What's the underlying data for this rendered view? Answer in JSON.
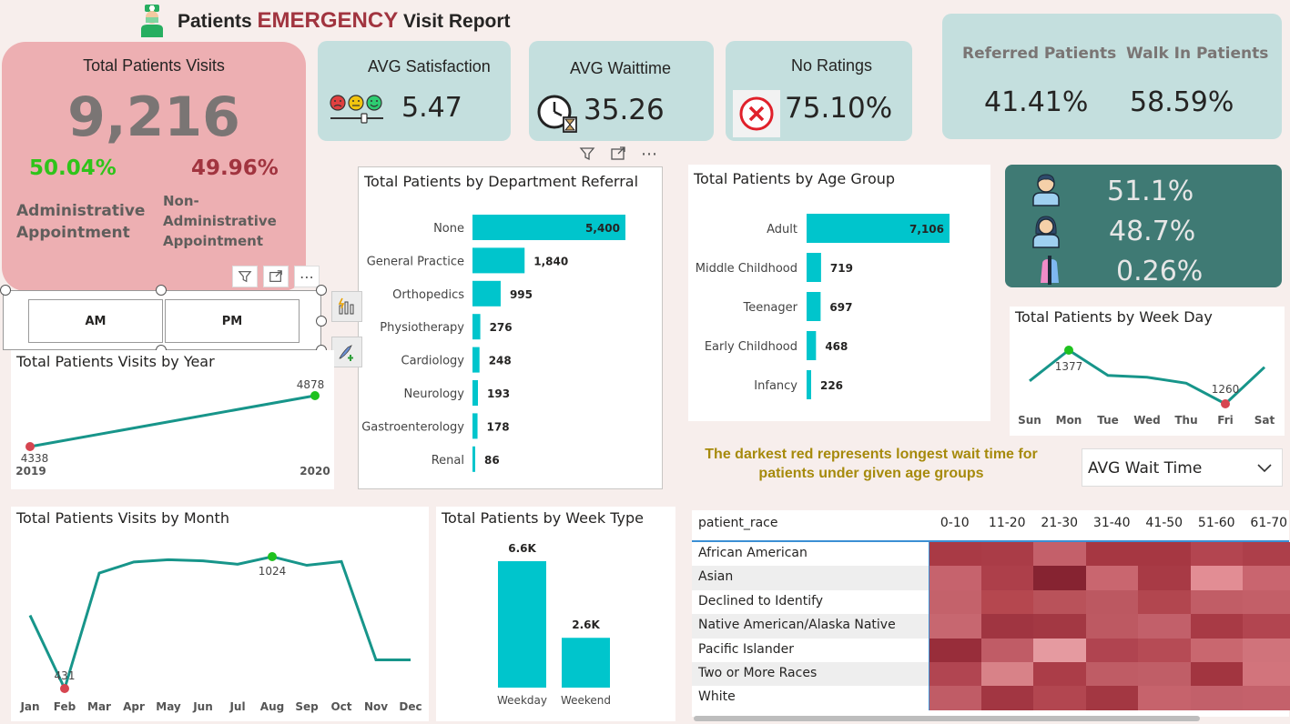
{
  "header": {
    "title_prefix": "Patients ",
    "title_highlight": "EMERGENCY",
    "title_suffix": " Visit Report"
  },
  "total_visits": {
    "label": "Total Patients Visits",
    "value": "9,216",
    "admin_pct": "50.04%",
    "admin_label_1": "Administrative",
    "admin_label_2": "Appointment",
    "nonadmin_pct": "49.96%",
    "nonadmin_label_1": "Non-",
    "nonadmin_label_2": "Administrative",
    "nonadmin_label_3": "Appointment"
  },
  "kpis": {
    "satisfaction_label": "AVG Satisfaction",
    "satisfaction_value": "5.47",
    "waittime_label": "AVG Waittime",
    "waittime_value": "35.26",
    "noratings_label": "No Ratings",
    "noratings_value": "75.10%",
    "referred_label": "Referred Patients",
    "referred_value": "41.41%",
    "walkin_label": "Walk In Patients",
    "walkin_value": "58.59%"
  },
  "gender": {
    "male": "51.1%",
    "female": "48.7%",
    "other": "0.26%"
  },
  "slicer": {
    "am": "AM",
    "pm": "PM"
  },
  "colors": {
    "teal": "#00c5cc",
    "line": "#17958a",
    "pink_card": "#edafb2",
    "kpi_card": "#c4dfde",
    "gender_card": "#3f7a74",
    "max_point": "#1fc21f",
    "min_point": "#d64550",
    "annotation": "#a68a0c"
  },
  "annotation": {
    "line1": "The darkest red represents longest wait time for",
    "line2": "patients under given age groups"
  },
  "dropdown": {
    "selected": "AVG Wait Time"
  },
  "chart_data": [
    {
      "type": "bar",
      "title": "Total Patients by Department Referral",
      "categories": [
        "None",
        "General Practice",
        "Orthopedics",
        "Physiotherapy",
        "Cardiology",
        "Neurology",
        "Gastroenterology",
        "Renal"
      ],
      "values": [
        5400,
        1840,
        995,
        276,
        248,
        193,
        178,
        86
      ],
      "labels": [
        "5,400",
        "1,840",
        "995",
        "276",
        "248",
        "193",
        "178",
        "86"
      ]
    },
    {
      "type": "bar",
      "title": "Total Patients by Age Group",
      "categories": [
        "Adult",
        "Middle Childhood",
        "Teenager",
        "Early Childhood",
        "Infancy"
      ],
      "values": [
        7106,
        719,
        697,
        468,
        226
      ],
      "labels": [
        "7,106",
        "719",
        "697",
        "468",
        "226"
      ]
    },
    {
      "type": "line",
      "title": "Total Patients Visits by Year",
      "x": [
        "2019",
        "2020"
      ],
      "values": [
        4338,
        4878
      ]
    },
    {
      "type": "line",
      "title": "Total Patients by Week Day",
      "x": [
        "Sun",
        "Mon",
        "Tue",
        "Wed",
        "Thu",
        "Fri",
        "Sat"
      ],
      "values": [
        1310,
        1377,
        1322,
        1318,
        1305,
        1260,
        1340
      ],
      "shown_labels": {
        "1": "1377",
        "5": "1260"
      }
    },
    {
      "type": "line",
      "title": "Total Patients Visits by Month",
      "x": [
        "Jan",
        "Feb",
        "Mar",
        "Apr",
        "May",
        "Jun",
        "Jul",
        "Aug",
        "Sep",
        "Oct",
        "Nov",
        "Dec"
      ],
      "values": [
        760,
        431,
        950,
        1000,
        1010,
        1005,
        990,
        1024,
        985,
        1002,
        560,
        560
      ],
      "shown_labels": {
        "1": "431",
        "7": "1024"
      }
    },
    {
      "type": "bar",
      "title": "Total Patients by Week Type",
      "categories": [
        "Weekday",
        "Weekend"
      ],
      "values": [
        6600,
        2600
      ],
      "labels": [
        "6.6K",
        "2.6K"
      ]
    },
    {
      "type": "heatmap",
      "row_header": "patient_race",
      "columns": [
        "0-10",
        "11-20",
        "21-30",
        "31-40",
        "41-50",
        "51-60",
        "61-70"
      ],
      "rows": [
        "African American",
        "Asian",
        "Declined to Identify",
        "Native American/Alaska Native",
        "Pacific Islander",
        "Two or More Races",
        "White"
      ],
      "cells": [
        [
          "#a93a45",
          "#aa3c47",
          "#c4606a",
          "#a63742",
          "#a63742",
          "#b34550",
          "#ad3f4a"
        ],
        [
          "#c6636d",
          "#ad3f4a",
          "#862331",
          "#c9666f",
          "#a83a45",
          "#e28d94",
          "#c9656f"
        ],
        [
          "#c4626b",
          "#b5474f",
          "#b9525a",
          "#bc5861",
          "#b2464f",
          "#c15d66",
          "#c35f68"
        ],
        [
          "#c76770",
          "#a03541",
          "#a33843",
          "#bd5962",
          "#c2606a",
          "#a83a45",
          "#b24550"
        ],
        [
          "#982d3a",
          "#c05c66",
          "#e59aa0",
          "#b04450",
          "#b64b55",
          "#c9676f",
          "#d0737b"
        ],
        [
          "#b14551",
          "#d88288",
          "#ab3d48",
          "#bf5c65",
          "#c05e67",
          "#a23540",
          "#d2747c"
        ],
        [
          "#c05c66",
          "#a23642",
          "#b24650",
          "#a33742",
          "#c6636c",
          "#c2606a",
          "#c4616b"
        ]
      ]
    }
  ]
}
